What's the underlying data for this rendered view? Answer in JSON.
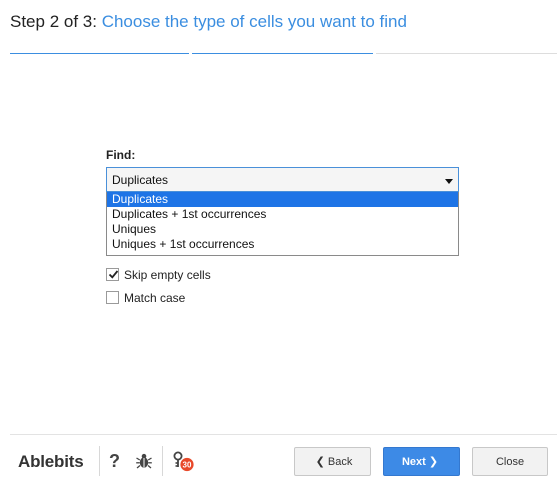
{
  "header": {
    "step": "Step 2 of 3:",
    "heading": "Choose the type of cells you want to find"
  },
  "progress": {
    "current_step": 2,
    "total_steps": 3
  },
  "find": {
    "label": "Find:",
    "selected": "Duplicates",
    "options": [
      "Duplicates",
      "Duplicates + 1st occurrences",
      "Uniques",
      "Uniques + 1st occurrences"
    ]
  },
  "options": {
    "skip_empty": {
      "label": "Skip empty cells",
      "checked": true
    },
    "match_case": {
      "label": "Match case",
      "checked": false
    }
  },
  "footer": {
    "brand": "Ablebits",
    "help": "?",
    "badge_count": "30",
    "back_label": "Back",
    "next_label": "Next",
    "close_label": "Close"
  },
  "colors": {
    "accent": "#3b8ee0",
    "selection": "#1e74e6",
    "next_button": "#3d8ae6",
    "badge": "#e8492a"
  },
  "icons": {
    "help": "question-mark-icon",
    "bug": "bug-icon",
    "notifications": "key-badge-icon",
    "back": "chevron-left-icon",
    "next": "chevron-right-icon",
    "dropdown": "caret-down-icon"
  }
}
